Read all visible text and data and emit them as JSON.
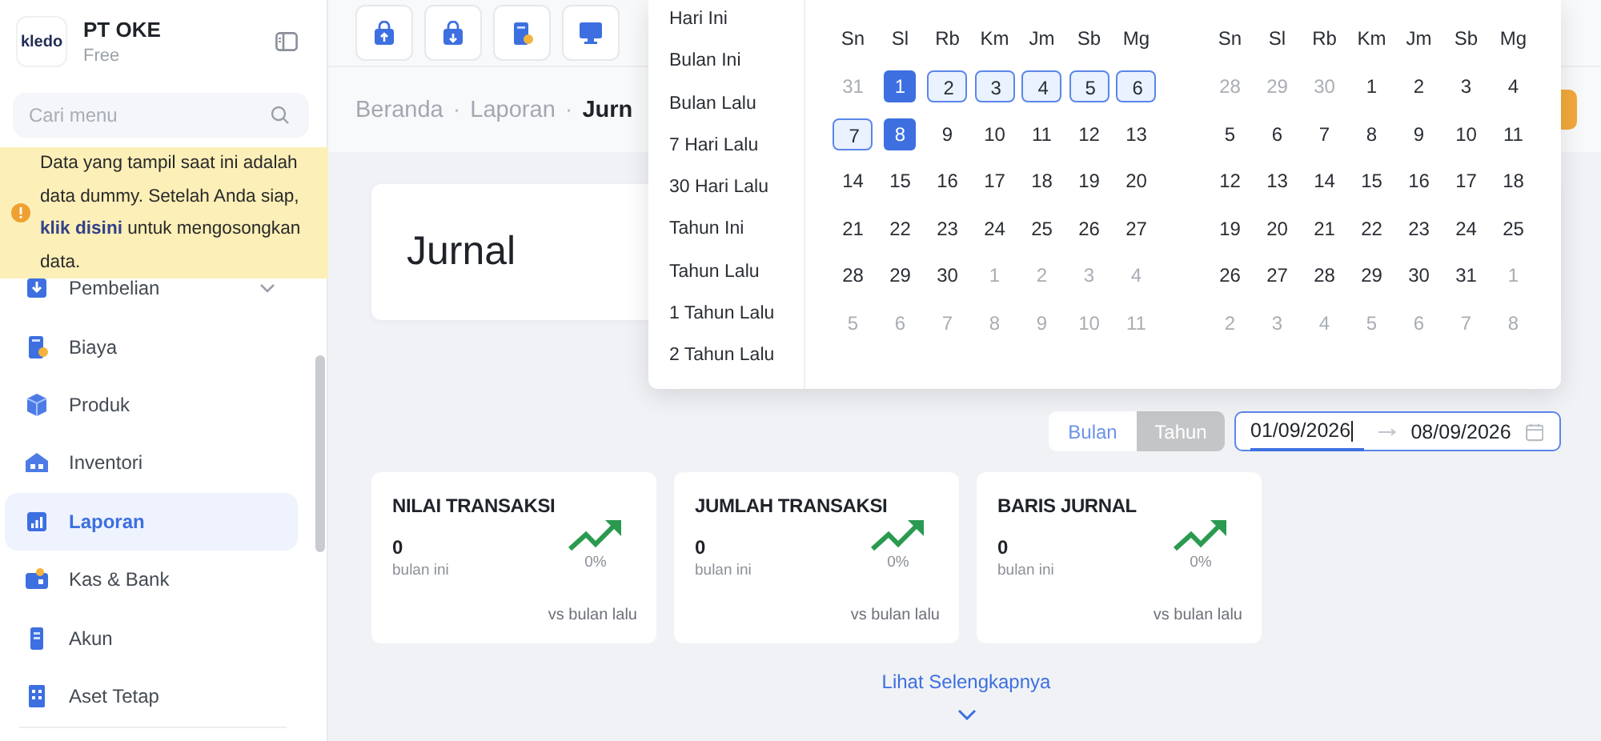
{
  "company": {
    "name": "PT OKE",
    "plan": "Free",
    "logo": "kledo"
  },
  "search": {
    "placeholder": "Cari menu"
  },
  "banner": {
    "text_before": "Data yang tampil saat ini adalah data dummy. Setelah Anda siap, ",
    "link": "klik disini",
    "text_after": " untuk mengosongkan data."
  },
  "menu": [
    {
      "label": "Pembelian",
      "selected": false,
      "expandable": true
    },
    {
      "label": "Biaya",
      "selected": false,
      "expandable": false
    },
    {
      "label": "Produk",
      "selected": false,
      "expandable": false
    },
    {
      "label": "Inventori",
      "selected": false,
      "expandable": false
    },
    {
      "label": "Laporan",
      "selected": true,
      "expandable": false
    },
    {
      "label": "Kas & Bank",
      "selected": false,
      "expandable": false
    },
    {
      "label": "Akun",
      "selected": false,
      "expandable": false
    },
    {
      "label": "Aset Tetap",
      "selected": false,
      "expandable": false
    }
  ],
  "breadcrumb": [
    {
      "kind": "link",
      "text": "Beranda"
    },
    {
      "kind": "separator",
      "text": "·"
    },
    {
      "kind": "link",
      "text": "Laporan"
    },
    {
      "kind": "separator",
      "text": "·"
    },
    {
      "kind": "current",
      "text": "Jurn"
    }
  ],
  "page_title": "Jurnal",
  "presets": [
    "Hari Ini",
    "Bulan Ini",
    "Bulan Lalu",
    "7 Hari Lalu",
    "30 Hari Lalu",
    "Tahun Ini",
    "Tahun Lalu",
    "1 Tahun Lalu",
    "2 Tahun Lalu"
  ],
  "calendars": [
    {
      "weekdays": [
        "Sn",
        "Sl",
        "Rb",
        "Km",
        "Jm",
        "Sb",
        "Mg"
      ],
      "weeks": [
        [
          {
            "d": "31",
            "kind": "muted"
          },
          {
            "d": "1",
            "kind": "selected"
          },
          {
            "d": "2",
            "kind": "range"
          },
          {
            "d": "3",
            "kind": "range"
          },
          {
            "d": "4",
            "kind": "range"
          },
          {
            "d": "5",
            "kind": "range"
          },
          {
            "d": "6",
            "kind": "range"
          }
        ],
        [
          {
            "d": "7",
            "kind": "range"
          },
          {
            "d": "8",
            "kind": "selected"
          },
          {
            "d": "9",
            "kind": "day"
          },
          {
            "d": "10",
            "kind": "day"
          },
          {
            "d": "11",
            "kind": "day"
          },
          {
            "d": "12",
            "kind": "day"
          },
          {
            "d": "13",
            "kind": "day"
          }
        ],
        [
          {
            "d": "14",
            "kind": "day"
          },
          {
            "d": "15",
            "kind": "day"
          },
          {
            "d": "16",
            "kind": "day"
          },
          {
            "d": "17",
            "kind": "day"
          },
          {
            "d": "18",
            "kind": "day"
          },
          {
            "d": "19",
            "kind": "day"
          },
          {
            "d": "20",
            "kind": "day"
          }
        ],
        [
          {
            "d": "21",
            "kind": "day"
          },
          {
            "d": "22",
            "kind": "day"
          },
          {
            "d": "23",
            "kind": "day"
          },
          {
            "d": "24",
            "kind": "day"
          },
          {
            "d": "25",
            "kind": "day"
          },
          {
            "d": "26",
            "kind": "day"
          },
          {
            "d": "27",
            "kind": "day"
          }
        ],
        [
          {
            "d": "28",
            "kind": "day"
          },
          {
            "d": "29",
            "kind": "day"
          },
          {
            "d": "30",
            "kind": "day"
          },
          {
            "d": "1",
            "kind": "muted"
          },
          {
            "d": "2",
            "kind": "muted"
          },
          {
            "d": "3",
            "kind": "muted"
          },
          {
            "d": "4",
            "kind": "muted"
          }
        ],
        [
          {
            "d": "5",
            "kind": "muted"
          },
          {
            "d": "6",
            "kind": "muted"
          },
          {
            "d": "7",
            "kind": "muted"
          },
          {
            "d": "8",
            "kind": "muted"
          },
          {
            "d": "9",
            "kind": "muted"
          },
          {
            "d": "10",
            "kind": "muted"
          },
          {
            "d": "11",
            "kind": "muted"
          }
        ]
      ]
    },
    {
      "weekdays": [
        "Sn",
        "Sl",
        "Rb",
        "Km",
        "Jm",
        "Sb",
        "Mg"
      ],
      "weeks": [
        [
          {
            "d": "28",
            "kind": "muted"
          },
          {
            "d": "29",
            "kind": "muted"
          },
          {
            "d": "30",
            "kind": "muted"
          },
          {
            "d": "1",
            "kind": "day"
          },
          {
            "d": "2",
            "kind": "day"
          },
          {
            "d": "3",
            "kind": "day"
          },
          {
            "d": "4",
            "kind": "day"
          }
        ],
        [
          {
            "d": "5",
            "kind": "day"
          },
          {
            "d": "6",
            "kind": "day"
          },
          {
            "d": "7",
            "kind": "day"
          },
          {
            "d": "8",
            "kind": "day"
          },
          {
            "d": "9",
            "kind": "day"
          },
          {
            "d": "10",
            "kind": "day"
          },
          {
            "d": "11",
            "kind": "day"
          }
        ],
        [
          {
            "d": "12",
            "kind": "day"
          },
          {
            "d": "13",
            "kind": "day"
          },
          {
            "d": "14",
            "kind": "day"
          },
          {
            "d": "15",
            "kind": "day"
          },
          {
            "d": "16",
            "kind": "day"
          },
          {
            "d": "17",
            "kind": "day"
          },
          {
            "d": "18",
            "kind": "day"
          }
        ],
        [
          {
            "d": "19",
            "kind": "day"
          },
          {
            "d": "20",
            "kind": "day"
          },
          {
            "d": "21",
            "kind": "day"
          },
          {
            "d": "22",
            "kind": "day"
          },
          {
            "d": "23",
            "kind": "day"
          },
          {
            "d": "24",
            "kind": "day"
          },
          {
            "d": "25",
            "kind": "day"
          }
        ],
        [
          {
            "d": "26",
            "kind": "day"
          },
          {
            "d": "27",
            "kind": "day"
          },
          {
            "d": "28",
            "kind": "day"
          },
          {
            "d": "29",
            "kind": "day"
          },
          {
            "d": "30",
            "kind": "day"
          },
          {
            "d": "31",
            "kind": "day"
          },
          {
            "d": "1",
            "kind": "muted"
          }
        ],
        [
          {
            "d": "2",
            "kind": "muted"
          },
          {
            "d": "3",
            "kind": "muted"
          },
          {
            "d": "4",
            "kind": "muted"
          },
          {
            "d": "5",
            "kind": "muted"
          },
          {
            "d": "6",
            "kind": "muted"
          },
          {
            "d": "7",
            "kind": "muted"
          },
          {
            "d": "8",
            "kind": "muted"
          }
        ]
      ]
    }
  ],
  "period_toggle": [
    {
      "label": "Bulan",
      "selected": true
    },
    {
      "label": "Tahun",
      "selected": false
    }
  ],
  "date_range": {
    "start": "01/09/2026",
    "end": "08/09/2026"
  },
  "cards": [
    {
      "title": "NILAI TRANSAKSI",
      "value": "0",
      "caption": "bulan ini",
      "change": "0%",
      "comparison": "vs bulan lalu"
    },
    {
      "title": "JUMLAH TRANSAKSI",
      "value": "0",
      "caption": "bulan ini",
      "change": "0%",
      "comparison": "vs bulan lalu"
    },
    {
      "title": "BARIS JURNAL",
      "value": "0",
      "caption": "bulan ini",
      "change": "0%",
      "comparison": "vs bulan lalu"
    }
  ],
  "more_link": "Lihat Selengkapnya"
}
